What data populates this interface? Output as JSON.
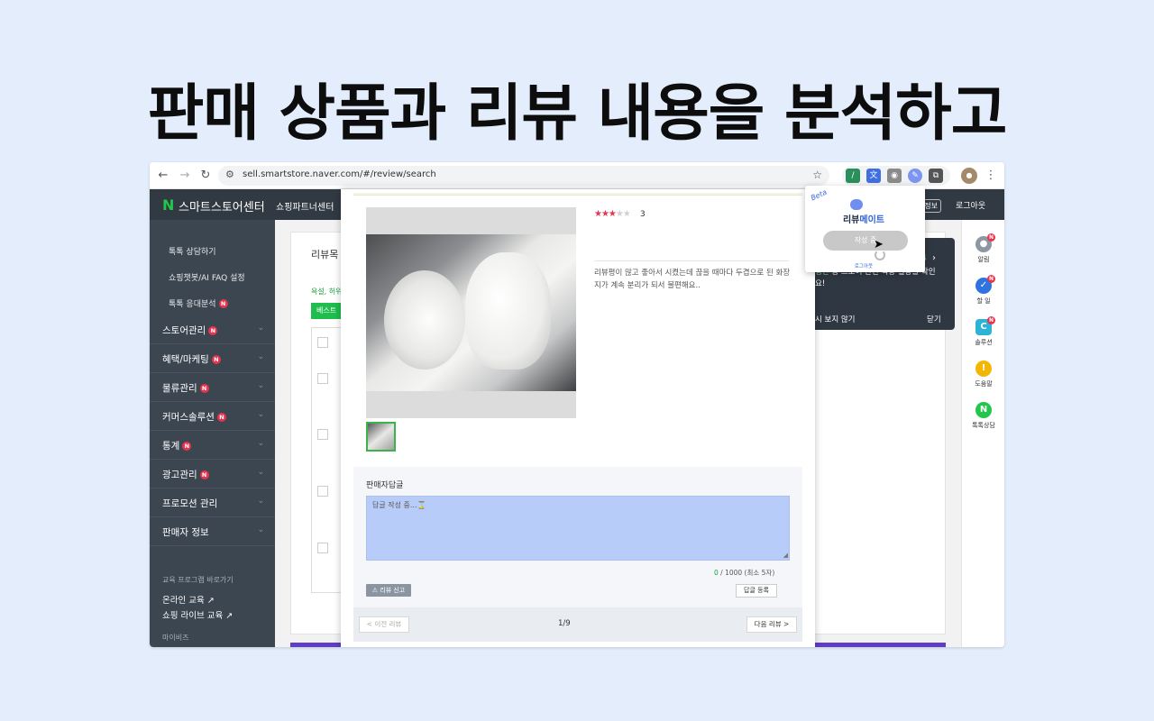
{
  "headline": "판매 상품과 리뷰 내용을 분석하고",
  "browser": {
    "url": "sell.smartstore.naver.com/#/review/search"
  },
  "topbar": {
    "logo_n": "N",
    "logo_text": "스마트스토어센터",
    "partner": "쇼핑파트너센터",
    "my_info": "내정보",
    "logout": "로그아웃"
  },
  "sidebar": {
    "sub_items": [
      "톡톡 상담하기",
      "쇼핑챗봇/AI FAQ 설정",
      "톡톡 응대분석"
    ],
    "main_items": [
      {
        "label": "스토어관리",
        "badge": "N"
      },
      {
        "label": "혜택/마케팅",
        "badge": "N"
      },
      {
        "label": "물류관리",
        "badge": "N"
      },
      {
        "label": "커머스솔루션",
        "badge": "N"
      },
      {
        "label": "통계",
        "badge": "N"
      },
      {
        "label": "광고관리",
        "badge": "N"
      },
      {
        "label": "프로모션 관리",
        "badge": ""
      },
      {
        "label": "판매자 정보",
        "badge": ""
      }
    ],
    "edu_header": "교육 프로그램 바로가기",
    "edu_links": [
      "온라인 교육 ↗",
      "쇼핑 라이브 교육 ↗"
    ],
    "mybiz": "마이비즈"
  },
  "content": {
    "title": "리뷰목",
    "green_text": "욕설, 허위",
    "best_button": "베스트"
  },
  "notice": {
    "num": "4",
    "text_green": "정산",
    "text_rest": " 등 스토어 관련 직상 실망을 확인요!",
    "never": "시 보지 않기",
    "close": "닫기"
  },
  "right_bar": [
    {
      "label": "알림",
      "icon": "bell-icon",
      "color": "#8d97a3",
      "glyph": "🔔"
    },
    {
      "label": "할 일",
      "icon": "check-icon",
      "color": "#2f73e0",
      "glyph": "✓"
    },
    {
      "label": "솔루션",
      "icon": "solution-icon",
      "color": "#2db3d6",
      "glyph": "C"
    },
    {
      "label": "도움말",
      "icon": "help-icon",
      "color": "#f2b705",
      "glyph": "!"
    },
    {
      "label": "톡톡상담",
      "icon": "talk-icon",
      "color": "#21c64b",
      "glyph": "N"
    }
  ],
  "review": {
    "stars_on": "★★★",
    "stars_off": "★★",
    "score": "3",
    "text": "리뷰평이 많고 좋아서 시켰는데 끊을 때마다 두겹으로 된 화장지가 계속 분리가 되서 불편해요..",
    "reply_label": "판매자답글",
    "reply_status": "답글 작성 중...⌛",
    "count_current": "0",
    "count_rest": " / 1000 (최소 5자)",
    "report_button": "⚠ 리뷰 신고",
    "submit_button": "답글 등록",
    "prev": "< 이전 리뷰",
    "pager": "1/9",
    "next": "다음 리뷰 >"
  },
  "popup": {
    "beta": "Beta",
    "title_a": "리뷰",
    "title_b": "메이트",
    "button": "작성 중",
    "logout": "로그아웃"
  }
}
